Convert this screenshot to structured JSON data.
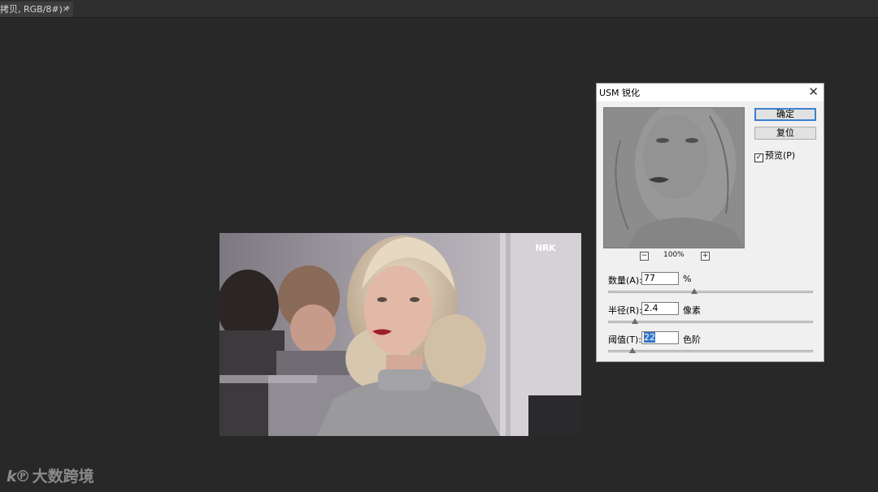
{
  "document_tab": {
    "title": "拷贝, RGB/8#) *",
    "close": "×"
  },
  "canvas": {
    "logo_text": "NRK"
  },
  "dialog": {
    "title": "USM 锐化",
    "close": "✕",
    "ok_button": "确定",
    "reset_button": "复位",
    "preview_checkbox": {
      "label": "预览(P)",
      "checked": true,
      "mark": "✓"
    },
    "zoom": {
      "minus": "−",
      "level": "100%",
      "plus": "+"
    },
    "amount": {
      "label": "数量(A):",
      "value": "77",
      "unit": "%",
      "slider_fraction": 0.42
    },
    "radius": {
      "label": "半径(R):",
      "value": "2.4",
      "unit": "像素",
      "slider_fraction": 0.13
    },
    "threshold": {
      "label": "阈值(T):",
      "value": "22",
      "unit": "色阶",
      "slider_fraction": 0.12
    }
  },
  "watermark": {
    "logo": "k℗",
    "text": "大数跨境"
  },
  "colors": {
    "workspace": "#282828",
    "dialog_bg": "#f0f0f0",
    "primary_border": "#3c7fd1",
    "selection": "#3373c4"
  }
}
